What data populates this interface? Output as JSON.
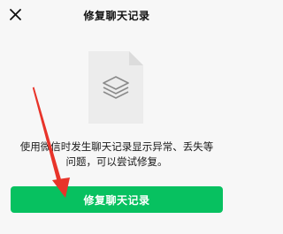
{
  "nav": {
    "title": "修复聊天记录",
    "close_icon": "close-icon"
  },
  "illustration": {
    "icon": "stack-layers-icon",
    "doc_color": "#ececec",
    "fold_color": "#dcdcdc"
  },
  "description": {
    "line1": "使用微信时发生聊天记录显示异常、丢失等",
    "line2": "问题，可以尝试修复。"
  },
  "primary_button": {
    "label": "修复聊天记录",
    "color": "#07c160"
  },
  "annotation": {
    "icon": "red-arrow-icon",
    "color": "#e8342a"
  }
}
